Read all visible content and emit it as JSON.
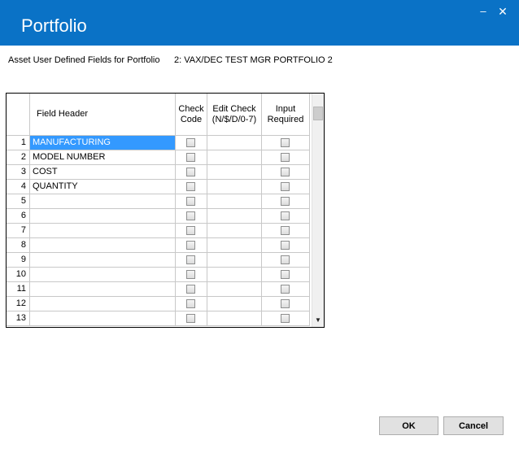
{
  "window": {
    "title": "Portfolio"
  },
  "labels": {
    "asset_udf": "Asset User Defined Fields for Portfolio",
    "portfolio_name": "2: VAX/DEC TEST MGR PORTFOLIO 2"
  },
  "grid": {
    "columns": {
      "field_header": "Field Header",
      "check_code": "Check\nCode",
      "edit_check": "Edit Check\n(N/$/D/0-7)",
      "input_required": "Input\nRequired"
    },
    "rows": [
      {
        "num": "1",
        "field": "MANUFACTURING",
        "check_code": false,
        "edit_check": "",
        "input_required": false,
        "selected": true
      },
      {
        "num": "2",
        "field": "MODEL NUMBER",
        "check_code": false,
        "edit_check": "",
        "input_required": false
      },
      {
        "num": "3",
        "field": "COST",
        "check_code": false,
        "edit_check": "",
        "input_required": false
      },
      {
        "num": "4",
        "field": "QUANTITY",
        "check_code": false,
        "edit_check": "",
        "input_required": false
      },
      {
        "num": "5",
        "field": "",
        "check_code": false,
        "edit_check": "",
        "input_required": false
      },
      {
        "num": "6",
        "field": "",
        "check_code": false,
        "edit_check": "",
        "input_required": false
      },
      {
        "num": "7",
        "field": "",
        "check_code": false,
        "edit_check": "",
        "input_required": false
      },
      {
        "num": "8",
        "field": "",
        "check_code": false,
        "edit_check": "",
        "input_required": false
      },
      {
        "num": "9",
        "field": "",
        "check_code": false,
        "edit_check": "",
        "input_required": false
      },
      {
        "num": "10",
        "field": "",
        "check_code": false,
        "edit_check": "",
        "input_required": false
      },
      {
        "num": "11",
        "field": "",
        "check_code": false,
        "edit_check": "",
        "input_required": false
      },
      {
        "num": "12",
        "field": "",
        "check_code": false,
        "edit_check": "",
        "input_required": false
      },
      {
        "num": "13",
        "field": "",
        "check_code": false,
        "edit_check": "",
        "input_required": false
      }
    ]
  },
  "buttons": {
    "ok": "OK",
    "cancel": "Cancel"
  },
  "icons": {
    "minimize": "minimize-icon",
    "close": "close-icon",
    "scroll_down": "scroll-down-arrow-icon"
  },
  "colors": {
    "titlebar": "#0a72c6",
    "selection": "#3399ff"
  }
}
